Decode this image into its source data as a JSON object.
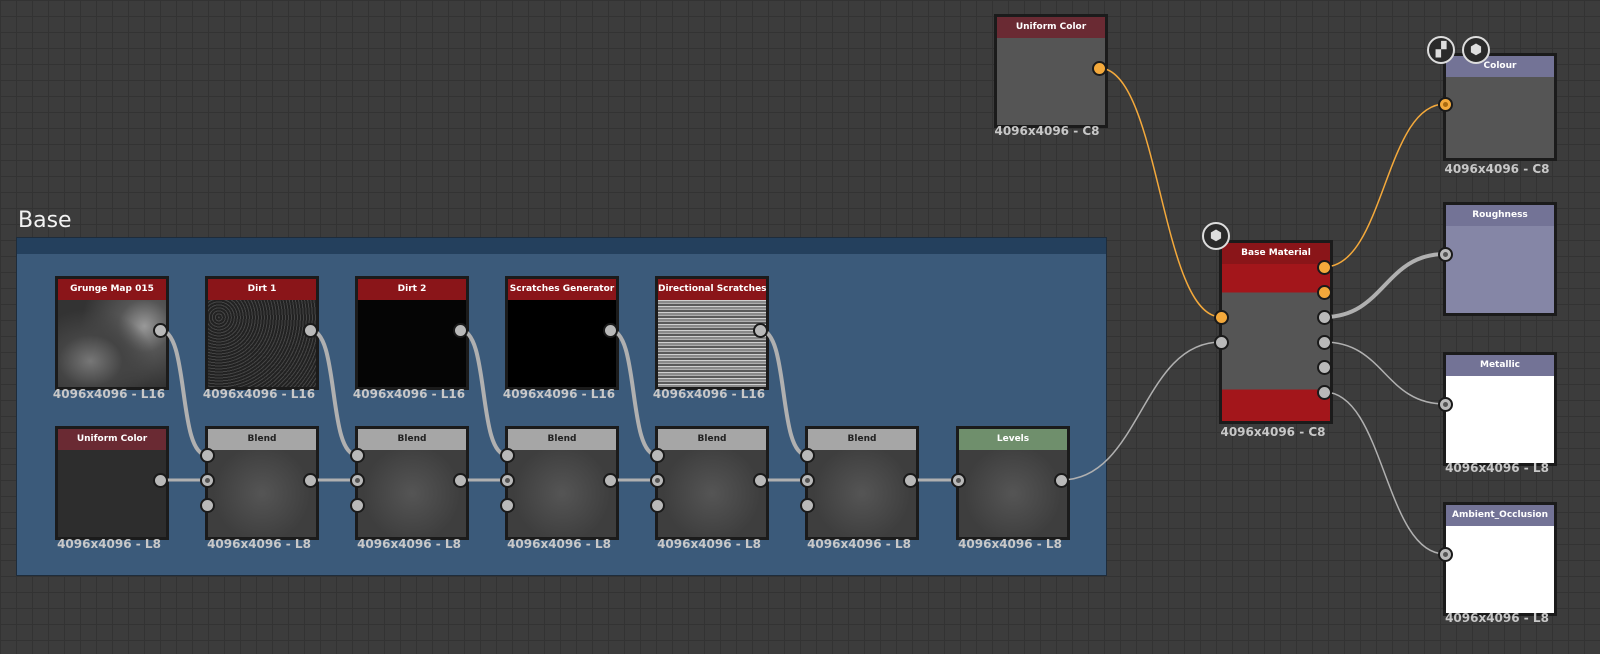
{
  "frame": {
    "title": "Base"
  },
  "nodes": {
    "grunge": {
      "title": "Grunge Map 015",
      "size": "4096x4096 - L16"
    },
    "dirt1": {
      "title": "Dirt 1",
      "size": "4096x4096 - L16"
    },
    "dirt2": {
      "title": "Dirt 2",
      "size": "4096x4096 - L16"
    },
    "scratches": {
      "title": "Scratches Generator",
      "size": "4096x4096 - L16"
    },
    "directional": {
      "title": "Directional Scratches",
      "size": "4096x4096 - L16"
    },
    "uniform_base": {
      "title": "Uniform Color",
      "size": "4096x4096 - L8"
    },
    "blend1": {
      "title": "Blend",
      "size": "4096x4096 - L8"
    },
    "blend2": {
      "title": "Blend",
      "size": "4096x4096 - L8"
    },
    "blend3": {
      "title": "Blend",
      "size": "4096x4096 - L8"
    },
    "blend4": {
      "title": "Blend",
      "size": "4096x4096 - L8"
    },
    "blend5": {
      "title": "Blend",
      "size": "4096x4096 - L8"
    },
    "levels": {
      "title": "Levels",
      "size": "4096x4096 - L8"
    },
    "uniform_top": {
      "title": "Uniform Color",
      "size": "4096x4096 - C8"
    },
    "base_material": {
      "title": "Base Material",
      "size": "4096x4096 - C8"
    },
    "colour": {
      "title": "Colour",
      "size": "4096x4096 - C8"
    },
    "roughness": {
      "title": "Roughness",
      "size": ""
    },
    "metallic": {
      "title": "Metallic",
      "size": "4096x4096 - L8"
    },
    "ao": {
      "title": "Ambient_Occlusion",
      "size": "4096x4096 - L8"
    }
  },
  "icons": [
    "cube-icon",
    "checker-icon"
  ],
  "colors": {
    "wire_orange": "#f4a93b",
    "wire_grey": "#b0b0b0",
    "frame": "#3b5a7a"
  }
}
